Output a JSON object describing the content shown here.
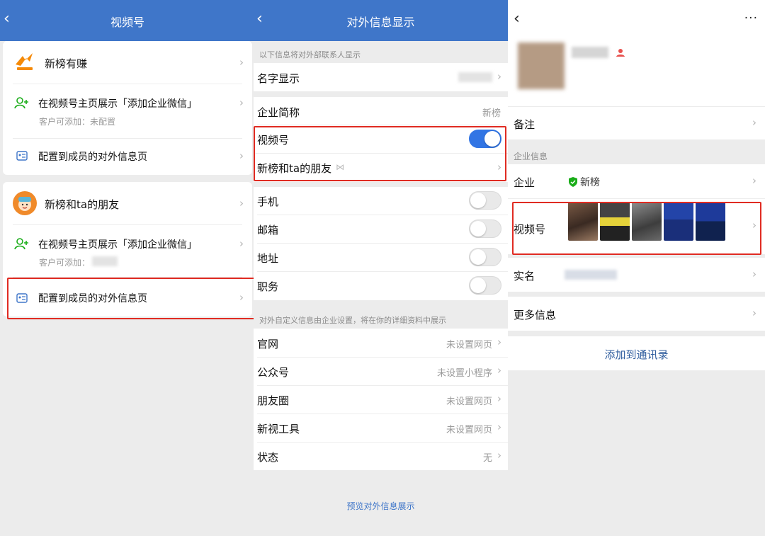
{
  "left": {
    "title": "视频号",
    "back_icon": "chevron-left-icon",
    "items": [
      {
        "name": "新榜有赚"
      },
      {
        "action": "在视频号主页展示「添加企业微信」",
        "sub": "客户可添加：未配置"
      },
      {
        "config": "配置到成员的对外信息页"
      },
      {
        "name": "新榜和ta的朋友"
      },
      {
        "action": "在视频号主页展示「添加企业微信」",
        "sub": "客户可添加："
      },
      {
        "config": "配置到成员的对外信息页"
      }
    ]
  },
  "middle": {
    "more": "···",
    "title": "对外信息显示",
    "section1_note": "以下信息将对外部联系人显示",
    "name_display": "名字显示",
    "company_short": {
      "label": "企业简称",
      "value": "新榜"
    },
    "channels": {
      "label": "视频号",
      "on": true
    },
    "friends": {
      "label": "新榜和ta的朋友",
      "tag": "⋈"
    },
    "toggles": [
      {
        "label": "手机",
        "on": false
      },
      {
        "label": "邮箱",
        "on": false
      },
      {
        "label": "地址",
        "on": false
      },
      {
        "label": "职务",
        "on": false
      }
    ],
    "section2_note": "对外自定义信息由企业设置，将在你的详细资料中展示",
    "custom": [
      {
        "label": "官网",
        "value": "未设置网页"
      },
      {
        "label": "公众号",
        "value": "未设置小程序"
      },
      {
        "label": "朋友圈",
        "value": "未设置网页"
      },
      {
        "label": "新视工具",
        "value": "未设置网页"
      },
      {
        "label": "状态",
        "value": "无"
      }
    ],
    "preview_link": "预览对外信息展示"
  },
  "right": {
    "more": "···",
    "remark": "备注",
    "enterprise_section": "企业信息",
    "enterprise": {
      "label": "企业",
      "value": "新榜"
    },
    "channels": {
      "label": "视频号"
    },
    "real_name": "实名",
    "more_info": "更多信息",
    "add_contact": "添加到通讯录"
  },
  "colors": {
    "brand_blue": "#3f76c9",
    "accent_red": "#e02b22",
    "toggle_on": "#3275e4"
  }
}
